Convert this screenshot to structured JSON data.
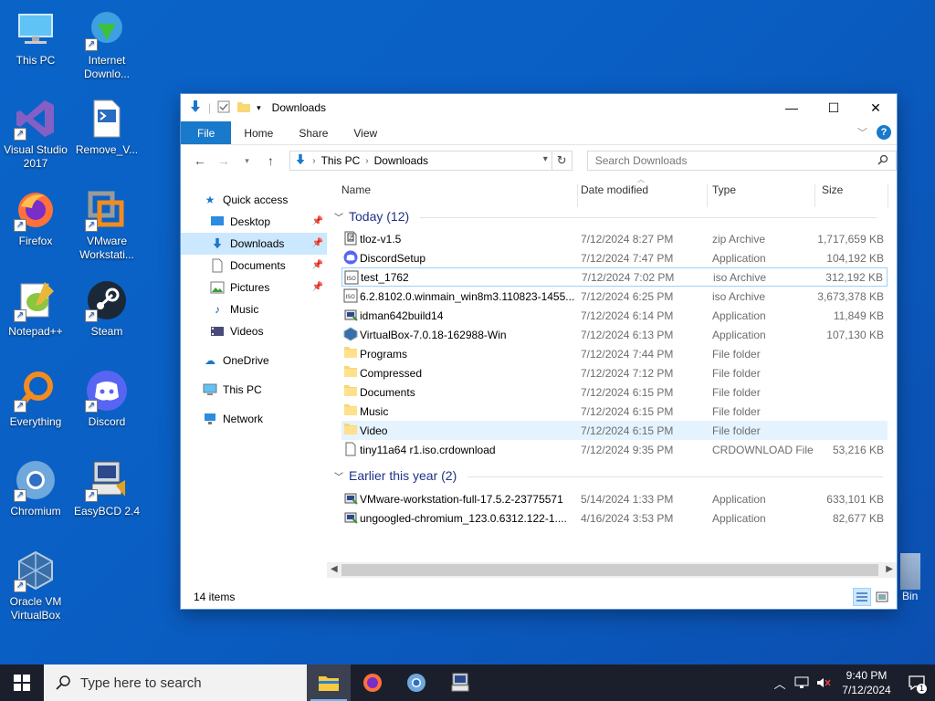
{
  "desktop": {
    "icons": [
      {
        "label": "This PC"
      },
      {
        "label": "Internet Downlo..."
      },
      {
        "label": "Visual Studio 2017"
      },
      {
        "label": "Remove_V..."
      },
      {
        "label": "Firefox"
      },
      {
        "label": "VMware Workstati..."
      },
      {
        "label": "Notepad++"
      },
      {
        "label": "Steam"
      },
      {
        "label": "Everything"
      },
      {
        "label": "Discord"
      },
      {
        "label": "Chromium"
      },
      {
        "label": "EasyBCD 2.4"
      },
      {
        "label": "Oracle VM VirtualBox"
      }
    ],
    "recycle_bin_partial": "Bin"
  },
  "window": {
    "title": "Downloads",
    "ribbon_tabs": [
      "File",
      "Home",
      "Share",
      "View"
    ],
    "address": {
      "crumbs": [
        "This PC",
        "Downloads"
      ]
    },
    "search_placeholder": "Search Downloads",
    "nav": {
      "quick_access": "Quick access",
      "items": [
        "Desktop",
        "Downloads",
        "Documents",
        "Pictures",
        "Music",
        "Videos"
      ],
      "onedrive": "OneDrive",
      "this_pc": "This PC",
      "network": "Network"
    },
    "columns": {
      "name": "Name",
      "date": "Date modified",
      "type": "Type",
      "size": "Size"
    },
    "groups": [
      {
        "label": "Today (12)",
        "rows": [
          {
            "name": "tloz-v1.5",
            "date": "7/12/2024 8:27 PM",
            "type": "zip Archive",
            "size": "1,717,659 KB",
            "icon": "zip-icon"
          },
          {
            "name": "DiscordSetup",
            "date": "7/12/2024 7:47 PM",
            "type": "Application",
            "size": "104,192 KB",
            "icon": "discord-icon"
          },
          {
            "name": "test_1762",
            "date": "7/12/2024 7:02 PM",
            "type": "iso Archive",
            "size": "312,192 KB",
            "icon": "iso-icon"
          },
          {
            "name": "6.2.8102.0.winmain_win8m3.110823-1455...",
            "date": "7/12/2024 6:25 PM",
            "type": "iso Archive",
            "size": "3,673,378 KB",
            "icon": "iso-icon"
          },
          {
            "name": "idman642build14",
            "date": "7/12/2024 6:14 PM",
            "type": "Application",
            "size": "11,849 KB",
            "icon": "installer-icon"
          },
          {
            "name": "VirtualBox-7.0.18-162988-Win",
            "date": "7/12/2024 6:13 PM",
            "type": "Application",
            "size": "107,130 KB",
            "icon": "virtualbox-icon"
          },
          {
            "name": "Programs",
            "date": "7/12/2024 7:44 PM",
            "type": "File folder",
            "size": "",
            "icon": "folder-icon"
          },
          {
            "name": "Compressed",
            "date": "7/12/2024 7:12 PM",
            "type": "File folder",
            "size": "",
            "icon": "folder-icon"
          },
          {
            "name": "Documents",
            "date": "7/12/2024 6:15 PM",
            "type": "File folder",
            "size": "",
            "icon": "folder-icon"
          },
          {
            "name": "Music",
            "date": "7/12/2024 6:15 PM",
            "type": "File folder",
            "size": "",
            "icon": "folder-icon"
          },
          {
            "name": "Video",
            "date": "7/12/2024 6:15 PM",
            "type": "File folder",
            "size": "",
            "icon": "folder-icon"
          },
          {
            "name": "tiny11a64 r1.iso.crdownload",
            "date": "7/12/2024 9:35 PM",
            "type": "CRDOWNLOAD File",
            "size": "53,216 KB",
            "icon": "file-icon"
          }
        ]
      },
      {
        "label": "Earlier this year (2)",
        "rows": [
          {
            "name": "VMware-workstation-full-17.5.2-23775571",
            "date": "5/14/2024 1:33 PM",
            "type": "Application",
            "size": "633,101 KB",
            "icon": "installer-icon"
          },
          {
            "name": "ungoogled-chromium_123.0.6312.122-1....",
            "date": "4/16/2024 3:53 PM",
            "type": "Application",
            "size": "82,677 KB",
            "icon": "installer-icon"
          }
        ]
      }
    ],
    "status": "14 items"
  },
  "taskbar": {
    "search_placeholder": "Type here to search",
    "time": "9:40 PM",
    "date": "7/12/2024",
    "notification_count": "1"
  },
  "colors": {
    "accent": "#1979ca",
    "selection": "#cce8ff",
    "desktop": "#0a64c8",
    "taskbar": "#1b1f2c"
  }
}
